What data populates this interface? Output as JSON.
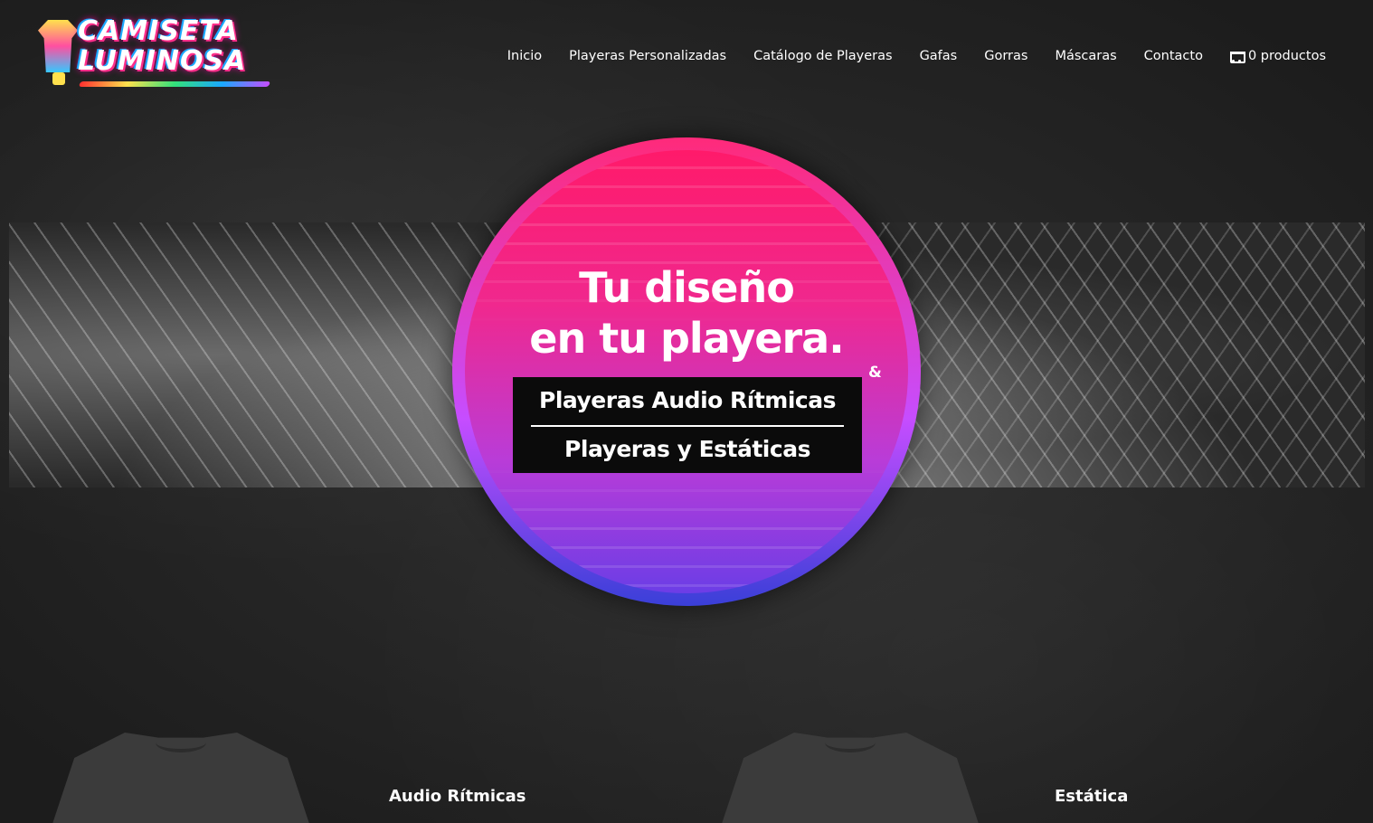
{
  "brand": {
    "logo_text": "CAMISETA LUMINOSA"
  },
  "nav": {
    "items": [
      {
        "label": "Inicio"
      },
      {
        "label": "Playeras Personalizadas"
      },
      {
        "label": "Catálogo de Playeras"
      },
      {
        "label": "Gafas"
      },
      {
        "label": "Gorras"
      },
      {
        "label": "Máscaras"
      },
      {
        "label": "Contacto"
      }
    ],
    "cart": {
      "icon": "cart-icon",
      "label": "0 productos"
    }
  },
  "hero": {
    "title": "Tu diseño\nen tu playera.",
    "ampersand": "&",
    "box_line1": "Playeras Audio Rítmicas",
    "box_line2": "Playeras y Estáticas",
    "colors": {
      "pink": "#ff1a6a",
      "purple": "#b93cd8",
      "blue": "#3a3fd8"
    }
  },
  "products": [
    {
      "label": "Audio Rítmicas"
    },
    {
      "label": "Estática"
    }
  ]
}
